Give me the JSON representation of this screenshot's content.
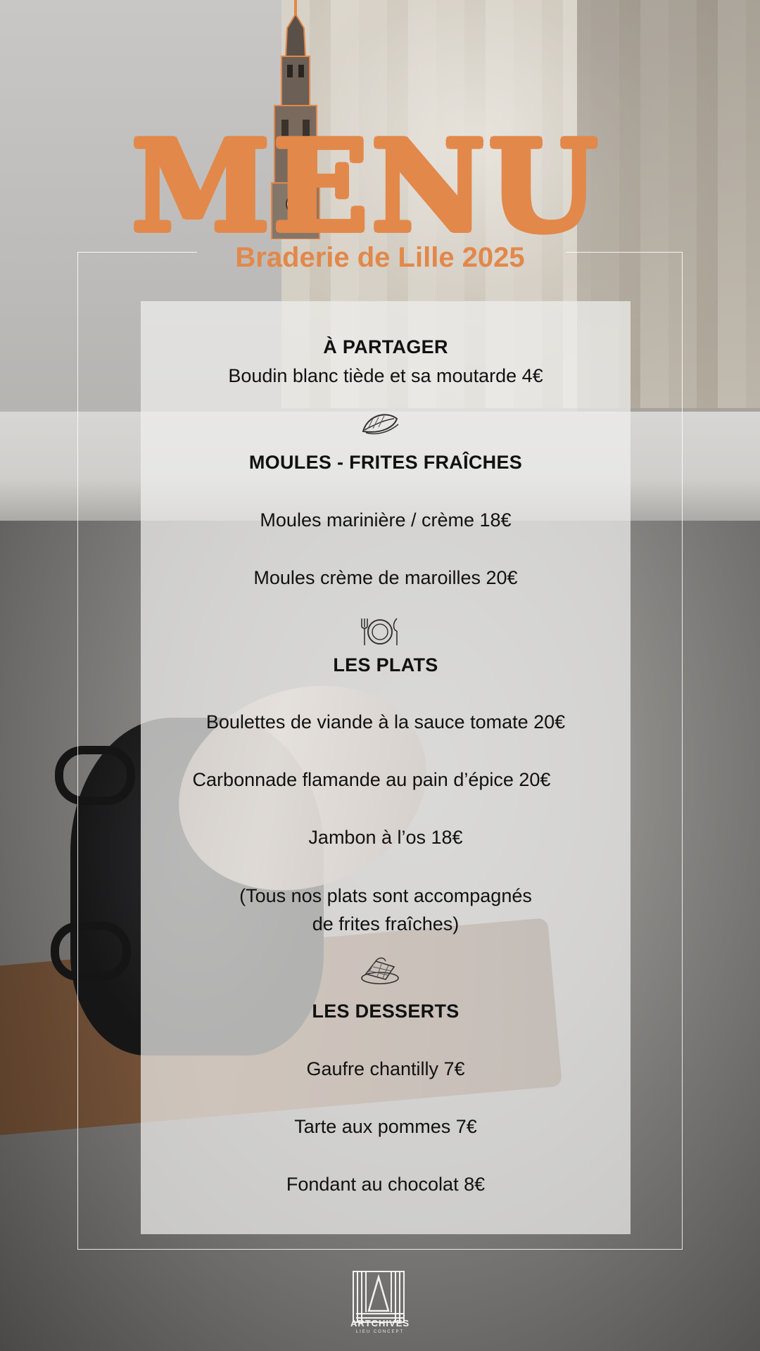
{
  "header": {
    "title": "MENU",
    "subtitle": "Braderie de Lille 2025"
  },
  "sections": [
    {
      "title": "À PARTAGER",
      "items": [
        "Boudin blanc tiède et sa moutarde 4€"
      ]
    },
    {
      "title": "MOULES - FRITES FRAÎCHES",
      "items": [
        "Moules marinière / crème 18€",
        "Moules crème de maroilles 20€"
      ]
    },
    {
      "title": "LES PLATS",
      "items": [
        "Boulettes de viande à la sauce tomate 20€",
        "Carbonnade flamande au pain d’épice 20€",
        "Jambon à l’os 18€"
      ],
      "note": [
        "(Tous nos plats sont accompagnés",
        "de frites fraîches)"
      ]
    },
    {
      "title": "LES DESSERTS",
      "items": [
        "Gaufre chantilly 7€",
        "Tarte aux pommes 7€",
        "Fondant au chocolat  8€"
      ]
    }
  ],
  "icons": {
    "partager": "mussel-icon",
    "plats": "plate-cutlery-icon",
    "desserts": "waffle-icon"
  },
  "colors": {
    "accent": "#e2884a",
    "text": "#111111",
    "panel": "#eeeeed"
  },
  "footer": {
    "logo_name": "ARTCHIVES",
    "logo_tagline": "LIEU CONCEPT"
  }
}
